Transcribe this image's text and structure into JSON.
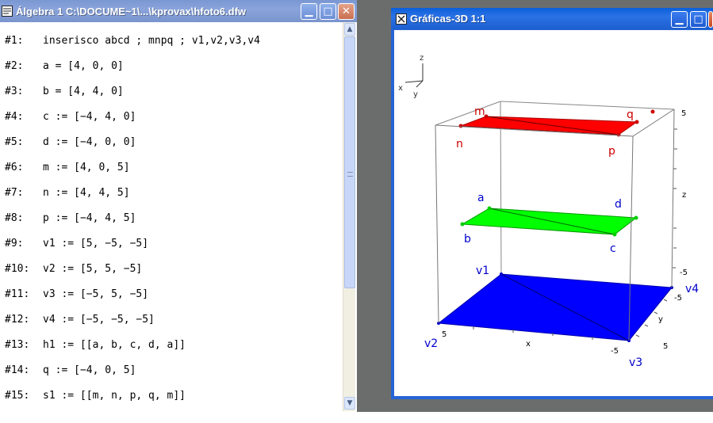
{
  "algebra_window": {
    "title": "Álgebra 1  C:\\DOCUME~1\\...\\kprovax\\hfoto6.dfw",
    "buttons": {
      "minimize": "▁",
      "maximize": "□",
      "close": "✕"
    },
    "lines": [
      {
        "label": "#1:",
        "expr": "inserisco abcd ; mnpq ; v1,v2,v3,v4"
      },
      {
        "label": "#2:",
        "expr": "a = [4, 0, 0]"
      },
      {
        "label": "#3:",
        "expr": "b = [4, 4, 0]"
      },
      {
        "label": "#4:",
        "expr": "c := [−4, 4, 0]"
      },
      {
        "label": "#5:",
        "expr": "d := [−4, 0, 0]"
      },
      {
        "label": "#6:",
        "expr": "m := [4, 0, 5]"
      },
      {
        "label": "#7:",
        "expr": "n := [4, 4, 5]"
      },
      {
        "label": "#8:",
        "expr": "p := [−4, 4, 5]"
      },
      {
        "label": "#9:",
        "expr": "v1 := [5, −5, −5]"
      },
      {
        "label": "#10:",
        "expr": "v2 := [5, 5, −5]"
      },
      {
        "label": "#11:",
        "expr": "v3 := [−5, 5, −5]"
      },
      {
        "label": "#12:",
        "expr": "v4 := [−5, −5, −5]"
      },
      {
        "label": "#13:",
        "expr": "h1 := [[a, b, c, d, a]]"
      },
      {
        "label": "#14:",
        "expr": "q := [−4, 0, 5]"
      },
      {
        "label": "#15:",
        "expr": "s1 := [[m, n, p, q, m]]"
      }
    ]
  },
  "graphics_window": {
    "title": "Gráficas-3D 1:1",
    "buttons": {
      "minimize": "▁",
      "maximize": "□",
      "close": "✕"
    },
    "axis_gizmo": {
      "z": "z",
      "x": "x",
      "y": "y"
    },
    "axis_labels": {
      "z": "z",
      "x": "x",
      "y": "y"
    },
    "tick_labels": {
      "z_top": "5",
      "z_bottom": "-5",
      "x_near": "5",
      "x_far": "-5",
      "y_near": "5",
      "y_far": "-5"
    },
    "points": {
      "m": "m",
      "q": "q",
      "n": "n",
      "p": "p",
      "a": "a",
      "d": "d",
      "b": "b",
      "c": "c",
      "v1": "v1",
      "v2": "v2",
      "v3": "v3",
      "v4": "v4"
    },
    "colors": {
      "top_plane": "#ff0000",
      "mid_plane": "#00ff00",
      "bottom_plane": "#0000ff",
      "top_labels": "#cc0000",
      "blue_labels": "#0000cc"
    }
  }
}
